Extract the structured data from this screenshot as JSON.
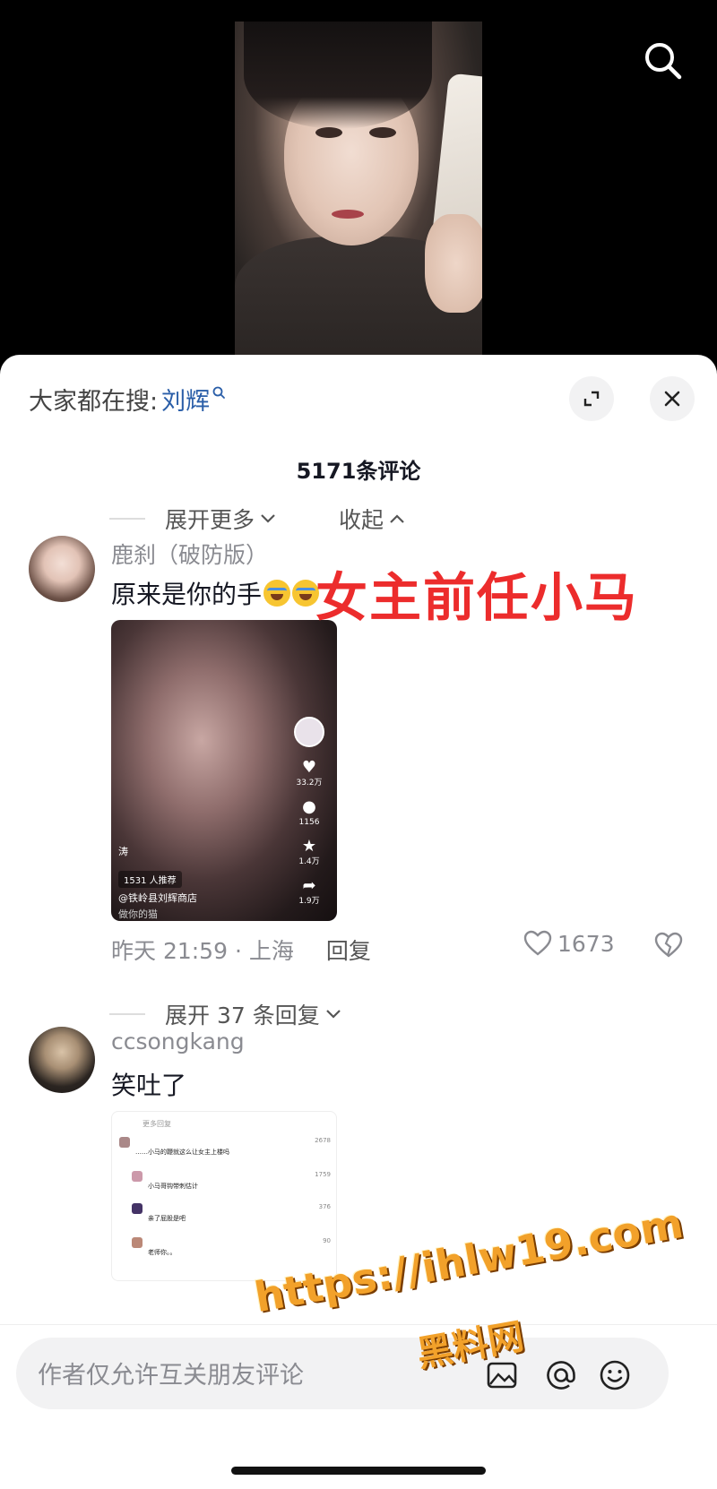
{
  "hot_search": {
    "prefix": "大家都在搜:",
    "keyword": "刘辉"
  },
  "comments_count": "5171条评论",
  "expander": {
    "more": "展开更多",
    "collapse": "收起"
  },
  "overlay_text": "女主前任小马",
  "comments": [
    {
      "username": "鹿刹（破防版）",
      "text": "原来是你的手",
      "video_thumb": {
        "likes": "33.2万",
        "comments": "1156",
        "favorites": "1.4万",
        "shares": "1.9万",
        "caption_name": "涛",
        "recommend": "1531 人推荐",
        "shop": "@铁岭县刘辉商店",
        "sub": "做你的猫"
      },
      "time": "昨天 21:59 · 上海",
      "reply_label": "回复",
      "likes": "1673",
      "expand_replies": "展开 37 条回复"
    },
    {
      "username": "ccsongkang",
      "text": "笑吐了",
      "screenshot": {
        "header": "更多回复",
        "rows": [
          {
            "text": "……小马的鞭就这么让女主上楼吗",
            "right": "2678"
          },
          {
            "text": "小马哥钩带刺估计",
            "right": "1759"
          },
          {
            "text": "亲了屁股是吧",
            "right": "376"
          },
          {
            "text": "老师你。。",
            "right": "90"
          }
        ]
      }
    }
  ],
  "watermark": {
    "url": "https://ihlw19.com",
    "name": "黑料网"
  },
  "input_placeholder": "作者仅允许互关朋友评论",
  "icons": [
    "search-icon",
    "expand-icon",
    "close-icon",
    "heart-icon",
    "broken-heart-icon",
    "image-icon",
    "at-icon",
    "emoji-icon"
  ]
}
